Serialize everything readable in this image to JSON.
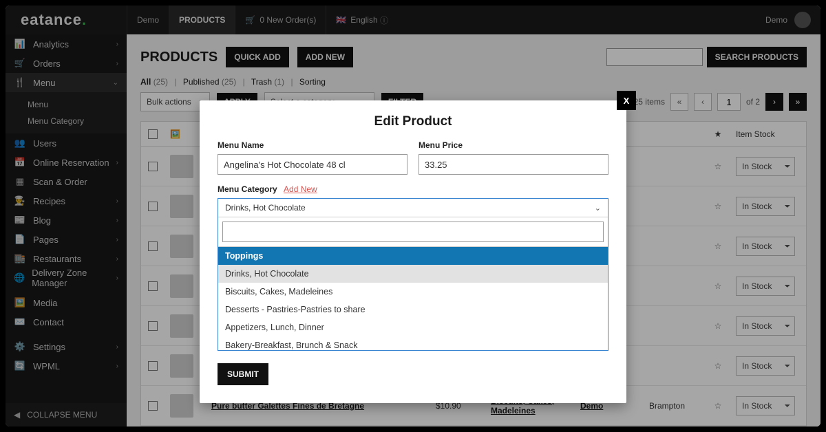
{
  "brand": "eatance",
  "topbar": {
    "demo": "Demo",
    "products": "PRODUCTS",
    "orders": "0 New Order(s)",
    "lang": "English",
    "user": "Demo"
  },
  "sidebar": {
    "analytics": "Analytics",
    "orders": "Orders",
    "menu": "Menu",
    "menu_sub1": "Menu",
    "menu_sub2": "Menu Category",
    "users": "Users",
    "reservation": "Online Reservation",
    "scan": "Scan & Order",
    "recipes": "Recipes",
    "blog": "Blog",
    "pages": "Pages",
    "restaurants": "Restaurants",
    "delivery": "Delivery Zone Manager",
    "media": "Media",
    "contact": "Contact",
    "settings": "Settings",
    "wpml": "WPML",
    "collapse": "COLLAPSE MENU"
  },
  "page": {
    "title": "PRODUCTS",
    "quick_add": "QUICK ADD",
    "add_new": "ADD NEW",
    "search_btn": "SEARCH PRODUCTS"
  },
  "subsubsub": {
    "all": "All",
    "all_count": "(25)",
    "published": "Published",
    "published_count": "(25)",
    "trash": "Trash",
    "trash_count": "(1)",
    "sorting": "Sorting"
  },
  "filters": {
    "bulk": "Bulk actions",
    "apply": "APPLY",
    "select_cat": "Select a category",
    "filter": "FILTER",
    "items": "25 items",
    "of": "of 2",
    "page": "1"
  },
  "table": {
    "headers": {
      "fav": "★",
      "stock": "Item Stock"
    },
    "stock_value": "In Stock",
    "rows": [
      {
        "name": "",
        "price": "",
        "cat": "",
        "rest": "",
        "loc": "",
        "thumb": "th-a"
      },
      {
        "name": "",
        "price": "",
        "cat": "",
        "rest": "",
        "loc": "",
        "thumb": "th-b"
      },
      {
        "name": "",
        "price": "",
        "cat": "",
        "rest": "",
        "loc": "",
        "thumb": "th-c"
      },
      {
        "name": "",
        "price": "",
        "cat": "",
        "rest": "",
        "loc": "",
        "thumb": "th-d"
      },
      {
        "name": "",
        "price": "",
        "cat": "",
        "rest": "",
        "loc": "",
        "thumb": "th-e"
      },
      {
        "name": "",
        "price": "",
        "cat": "",
        "rest": "",
        "loc": "",
        "thumb": "th-f"
      },
      {
        "name": "Pure butter Galettes Fines de Bretagne",
        "price": "$10.90",
        "cat": "Biscuits, Cakes, Madeleines",
        "rest": "Demo",
        "loc": "Brampton",
        "thumb": "th-g"
      }
    ]
  },
  "modal": {
    "title": "Edit Product",
    "close": "X",
    "name_label": "Menu Name",
    "name_value": "Angelina's Hot Chocolate 48 cl",
    "price_label": "Menu Price",
    "price_value": "33.25",
    "cat_label": "Menu Category",
    "add_new": "Add New",
    "selected_display": "Drinks, Hot Chocolate",
    "options": [
      {
        "text": "Toppings",
        "cls": "header"
      },
      {
        "text": "Drinks, Hot Chocolate",
        "cls": "selected"
      },
      {
        "text": "Biscuits, Cakes, Madeleines",
        "cls": ""
      },
      {
        "text": "Desserts - Pastries-Pastries to share",
        "cls": ""
      },
      {
        "text": "Appetizers, Lunch, Dinner",
        "cls": ""
      },
      {
        "text": "Bakery-Breakfast, Brunch & Snack",
        "cls": ""
      }
    ],
    "submit": "SUBMIT"
  }
}
